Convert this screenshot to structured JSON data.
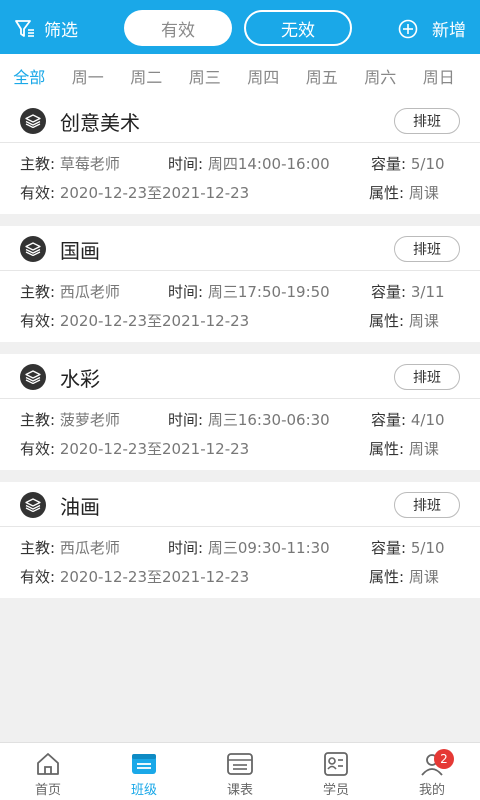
{
  "header": {
    "filter_label": "筛选",
    "tab_valid": "有效",
    "tab_invalid": "无效",
    "add_label": "新增"
  },
  "days": [
    "全部",
    "周一",
    "周二",
    "周三",
    "周四",
    "周五",
    "周六",
    "周日"
  ],
  "field_labels": {
    "teacher": "主教:",
    "time": "时间:",
    "capacity": "容量:",
    "valid": "有效:",
    "type": "属性:"
  },
  "classes": [
    {
      "name": "创意美术",
      "button": "排班",
      "teacher": "草莓老师",
      "time": "周四14:00-16:00",
      "capacity": "5/10",
      "valid_range": "2020-12-23至2021-12-23",
      "type": "周课"
    },
    {
      "name": "国画",
      "button": "排班",
      "teacher": "西瓜老师",
      "time": "周三17:50-19:50",
      "capacity": "3/11",
      "valid_range": "2020-12-23至2021-12-23",
      "type": "周课"
    },
    {
      "name": "水彩",
      "button": "排班",
      "teacher": "菠萝老师",
      "time": "周三16:30-06:30",
      "capacity": "4/10",
      "valid_range": "2020-12-23至2021-12-23",
      "type": "周课"
    },
    {
      "name": "油画",
      "button": "排班",
      "teacher": "西瓜老师",
      "time": "周三09:30-11:30",
      "capacity": "5/10",
      "valid_range": "2020-12-23至2021-12-23",
      "type": "周课"
    }
  ],
  "tabbar": {
    "items": [
      "首页",
      "班级",
      "课表",
      "学员",
      "我的"
    ],
    "badge": "2"
  },
  "colors": {
    "accent": "#1aa8e8",
    "badge": "#e53935"
  }
}
